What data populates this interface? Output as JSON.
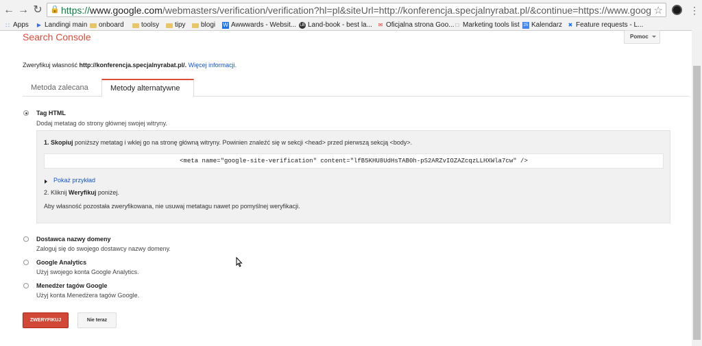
{
  "browser": {
    "url_scheme": "https://",
    "url_host": "www.google.com",
    "url_rest": "/webmasters/verification/verification?hl=pl&siteUrl=http://konferencja.specjalnyrabat.pl/&continue=https://www.google.com/webmasters/",
    "bookmarks": [
      {
        "label": "Apps",
        "icon": "apps-grid-icon"
      },
      {
        "label": "Landingi main",
        "icon": "landingi-icon"
      },
      {
        "label": "onboard",
        "icon": "folder-icon"
      },
      {
        "label": "toolsy",
        "icon": "folder-icon"
      },
      {
        "label": "tipy",
        "icon": "folder-icon"
      },
      {
        "label": "blogi",
        "icon": "folder-icon"
      },
      {
        "label": "Awwwards - Websit...",
        "icon": "awwwards-icon"
      },
      {
        "label": "Land-book - best la...",
        "icon": "landbook-icon"
      },
      {
        "label": "Oficjalna strona Goo...",
        "icon": "gmail-icon"
      },
      {
        "label": "Marketing tools list",
        "icon": "page-icon"
      },
      {
        "label": "Kalendarz",
        "icon": "calendar-icon"
      },
      {
        "label": "Feature requests - L...",
        "icon": "tools-icon"
      }
    ]
  },
  "header": {
    "title": "Search Console",
    "help_label": "Pomoc"
  },
  "verify": {
    "prefix": "Zweryfikuj własność ",
    "site": "http://konferencja.specjalnyrabat.pl/.",
    "more_link": "Więcej informacji."
  },
  "tabs": [
    {
      "label": "Metoda zalecana",
      "active": false
    },
    {
      "label": "Metody alternatywne",
      "active": true
    }
  ],
  "options": {
    "html_tag": {
      "title": "Tag HTML",
      "desc": "Dodaj metatag do strony głównej swojej witryny.",
      "selected": true
    },
    "domain": {
      "title": "Dostawca nazwy domeny",
      "desc": "Zaloguj się do swojego dostawcy nazwy domeny.",
      "selected": false
    },
    "analytics": {
      "title": "Google Analytics",
      "desc": "Użyj swojego konta Google Analytics.",
      "selected": false
    },
    "tag_manager": {
      "title": "Menedżer tagów Google",
      "desc": "Użyj konta Menedżera tagów Google.",
      "selected": false
    }
  },
  "panel": {
    "step1_num": "1.",
    "step1_bold": "Skopiuj",
    "step1_rest": " poniższy metatag i wklej go na stronę główną witryny. Powinien znaleźć się w sekcji <head> przed pierwszą sekcją <body>.",
    "meta_tag": "<meta name=\"google-site-verification\" content=\"lfB5KHU8UdHsTAB0h-pS2ARZvIOZAZcqzLLHXWla7cw\" />",
    "show_example": "Pokaż przykład",
    "step2_prefix": "2. Kliknij ",
    "step2_bold": "Weryfikuj",
    "step2_suffix": " poniżej.",
    "note": "Aby własność pozostała zweryfikowana, nie usuwaj metatagu nawet po pomyślnej weryfikacji."
  },
  "buttons": {
    "verify": "ZWERYFIKUJ",
    "not_now": "Nie teraz"
  },
  "colors": {
    "accent_red": "#dd4b39",
    "link_blue": "#1155cc",
    "verify_button": "#d14836"
  }
}
